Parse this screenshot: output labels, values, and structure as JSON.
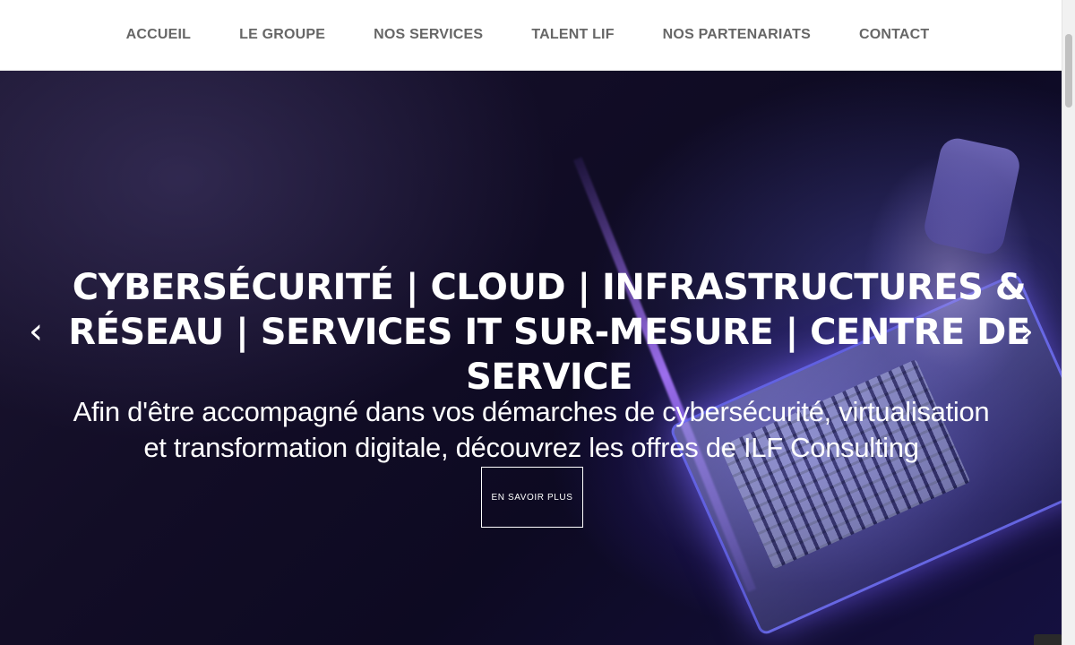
{
  "nav": {
    "items": [
      {
        "label": "ACCUEIL"
      },
      {
        "label": "LE GROUPE"
      },
      {
        "label": "NOS SERVICES"
      },
      {
        "label": "TALENT LIF"
      },
      {
        "label": "NOS PARTENARIATS"
      },
      {
        "label": "CONTACT"
      }
    ]
  },
  "hero": {
    "title": "CYBERSÉCURITÉ | CLOUD | INFRASTRUCTURES & RÉSEAU | SERVICES IT SUR-MESURE | CENTRE DE SERVICE",
    "subtitle": "Afin d'être accompagné dans vos démarches de cybersécurité, virtualisation et transformation digitale, découvrez les offres de ILF Consulting",
    "cta_label": "EN SAVOIR PLUS",
    "prev_icon": "‹",
    "next_icon": "›"
  },
  "icons": {
    "prev": "chevron-left-icon",
    "next": "chevron-right-icon"
  }
}
